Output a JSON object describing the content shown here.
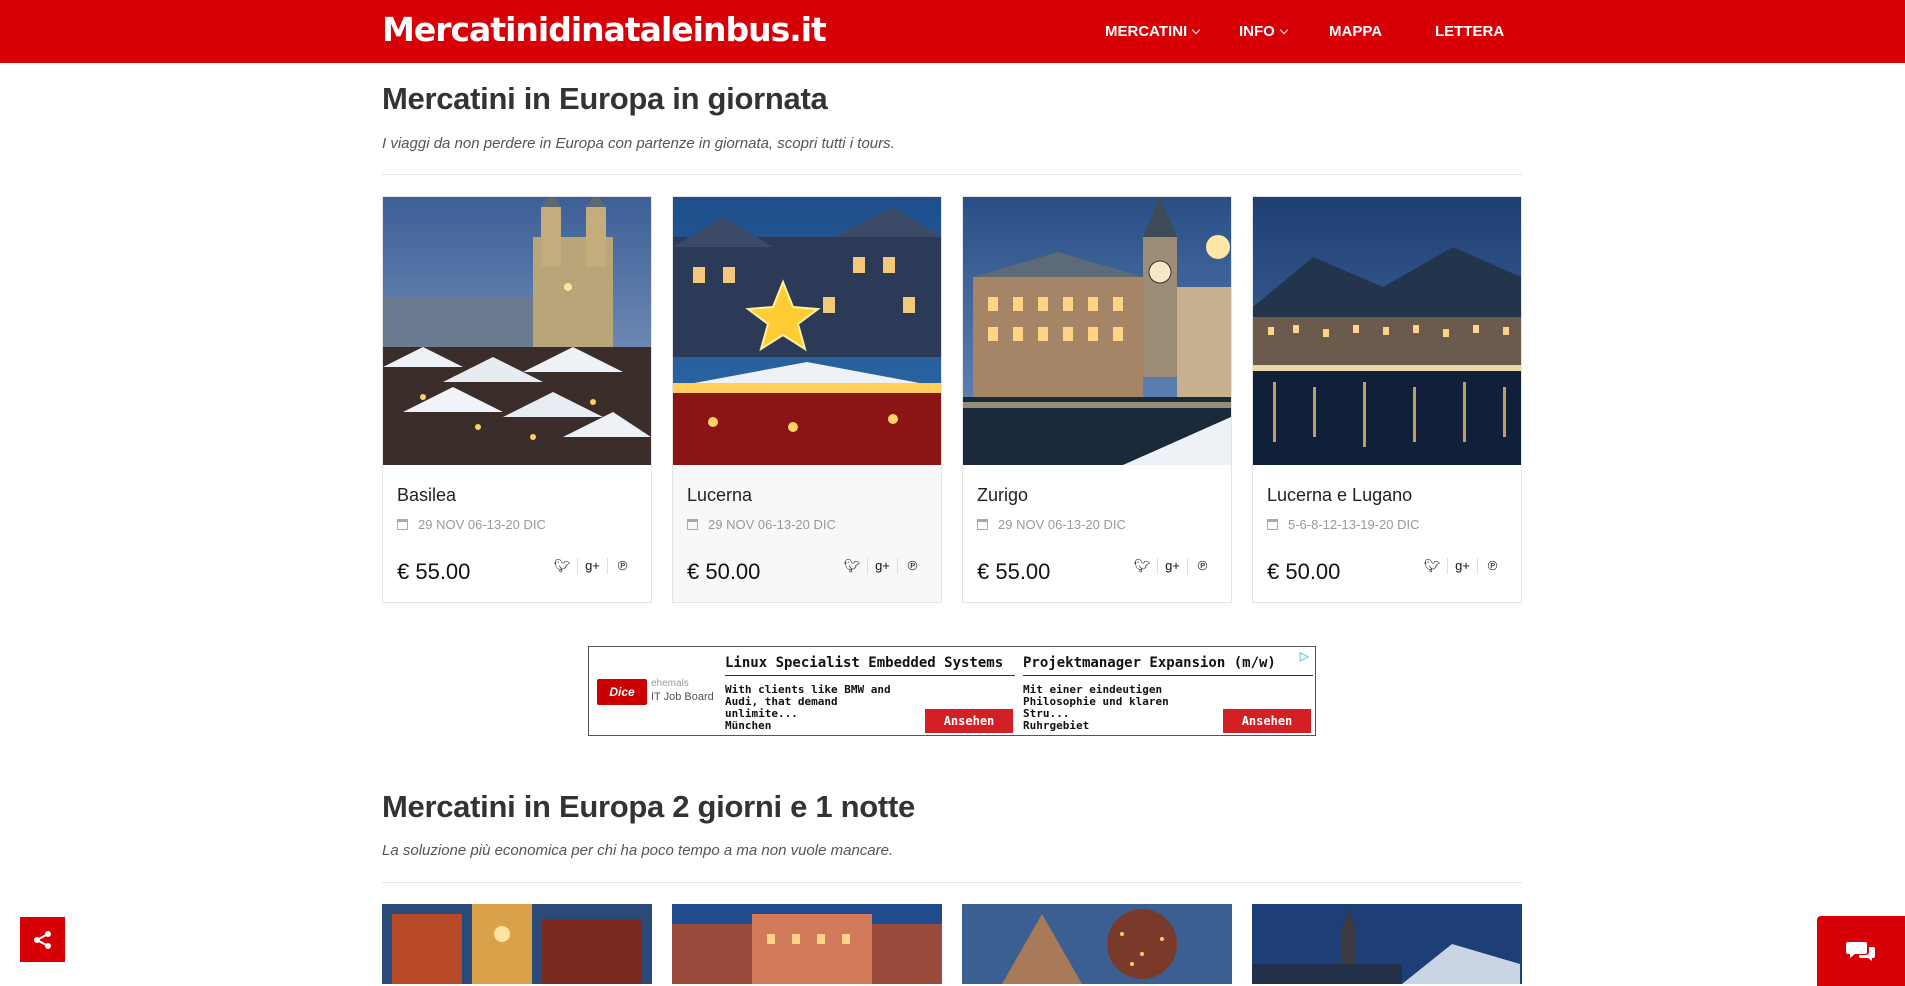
{
  "header": {
    "logo": "Mercatinidinataleinbus.it",
    "nav": [
      {
        "label": "MERCATINI",
        "has_dropdown": true
      },
      {
        "label": "INFO",
        "has_dropdown": true
      },
      {
        "label": "MAPPA",
        "has_dropdown": false
      },
      {
        "label": "LETTERA",
        "has_dropdown": false
      }
    ]
  },
  "section1": {
    "title": "Mercatini in Europa in giornata",
    "subtitle": "I viaggi da non perdere in Europa con partenze in giornata, scopri tutti i tours."
  },
  "tours": [
    {
      "name": "Basilea",
      "dates": "29 NOV 06-13-20 DIC",
      "price": "€ 55.00"
    },
    {
      "name": "Lucerna",
      "dates": "29 NOV 06-13-20 DIC",
      "price": "€ 50.00"
    },
    {
      "name": "Zurigo",
      "dates": "29 NOV 06-13-20 DIC",
      "price": "€ 55.00"
    },
    {
      "name": "Lucerna e Lugano",
      "dates": "5-6-8-12-13-19-20 DIC",
      "price": "€ 50.00"
    }
  ],
  "social_icons": [
    "twitter-icon",
    "google-plus-icon",
    "pinterest-icon"
  ],
  "ad": {
    "logo": "Dice",
    "brand_line1": "ehemals",
    "brand_line2": "IT Job Board",
    "jobs": [
      {
        "title": "Linux Specialist Embedded Systems",
        "desc": "With clients like BMW and Audi, that demand unlimite...",
        "location": "München",
        "button": "Ansehen"
      },
      {
        "title": "Projektmanager Expansion (m/w)",
        "desc": "Mit einer eindeutigen Philosophie und klaren Stru...",
        "location": "Ruhrgebiet",
        "button": "Ansehen"
      }
    ]
  },
  "section2": {
    "title": "Mercatini in Europa 2 giorni e 1 notte",
    "subtitle": "La soluzione più economica per chi ha poco tempo a ma non vuole mancare."
  },
  "colors": {
    "brand_red": "#d70007",
    "ad_button": "#d32027"
  }
}
